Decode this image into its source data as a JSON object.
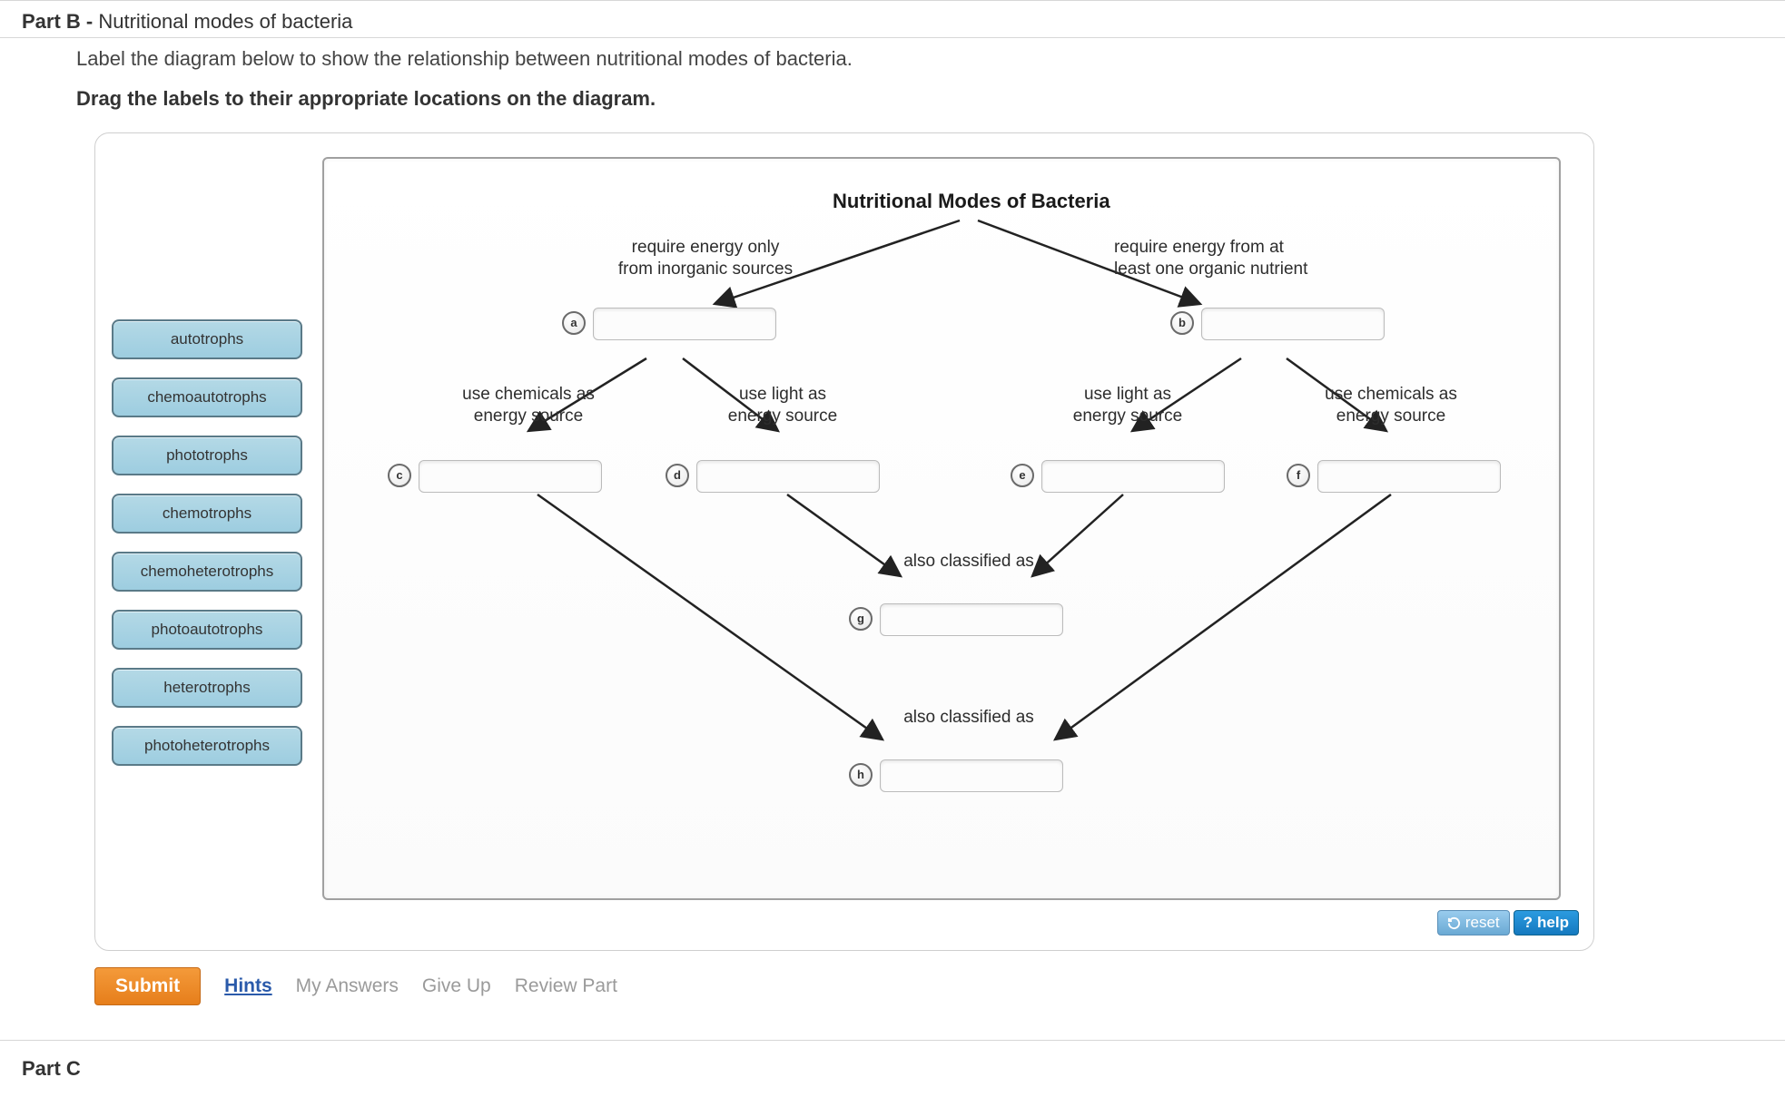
{
  "partB": {
    "header_prefix": "Part B - ",
    "header_title": "Nutritional modes of bacteria",
    "intro": "Label the diagram below to show the relationship between nutritional modes of bacteria.",
    "instruction": "Drag the labels to their appropriate locations on the diagram."
  },
  "bank": [
    "autotrophs",
    "chemoautotrophs",
    "phototrophs",
    "chemotrophs",
    "chemoheterotrophs",
    "photoautotrophs",
    "heterotrophs",
    "photoheterotrophs"
  ],
  "diagram": {
    "title": "Nutritional Modes of Bacteria",
    "branch_left_line1": "require energy only",
    "branch_left_line2": "from inorganic sources",
    "branch_right_line1": "require energy from at",
    "branch_right_line2": "least one organic nutrient",
    "sub_chem_line1": "use chemicals as",
    "sub_chem_line2": "energy source",
    "sub_light_line1": "use light as",
    "sub_light_line2": "energy source",
    "also1": "also classified as",
    "also2": "also classified as",
    "markers": {
      "a": "a",
      "b": "b",
      "c": "c",
      "d": "d",
      "e": "e",
      "f": "f",
      "g": "g",
      "h": "h"
    }
  },
  "util": {
    "reset": "reset",
    "help": "help"
  },
  "actions": {
    "submit": "Submit",
    "hints": "Hints",
    "my_answers": "My Answers",
    "give_up": "Give Up",
    "review": "Review Part"
  },
  "partC": {
    "title": "Part C"
  }
}
